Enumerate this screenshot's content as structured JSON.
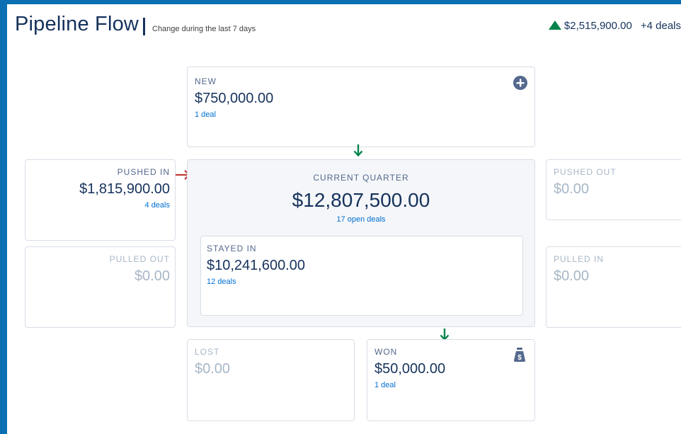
{
  "header": {
    "title": "Pipeline Flow",
    "subtitle": "Change during the last 7 days",
    "net_change": "$2,515,900.00",
    "net_deals": "+4 deals"
  },
  "cards": {
    "new": {
      "label": "NEW",
      "amount": "$750,000.00",
      "count": "1 deal"
    },
    "pushed_in": {
      "label": "PUSHED IN",
      "amount": "$1,815,900.00",
      "count": "4 deals"
    },
    "current_quarter": {
      "label": "CURRENT QUARTER",
      "amount": "$12,807,500.00",
      "count": "17 open deals"
    },
    "stayed_in": {
      "label": "STAYED IN",
      "amount": "$10,241,600.00",
      "count": "12 deals"
    },
    "pushed_out": {
      "label": "PUSHED OUT",
      "amount": "$0.00"
    },
    "pulled_out": {
      "label": "PULLED OUT",
      "amount": "$0.00"
    },
    "pulled_in": {
      "label": "PULLED IN",
      "amount": "$0.00"
    },
    "lost": {
      "label": "LOST",
      "amount": "$0.00"
    },
    "won": {
      "label": "WON",
      "amount": "$50,000.00",
      "count": "1 deal"
    }
  },
  "icons": {
    "add": "add-circle-icon",
    "money": "money-bag-icon",
    "arrow_positive": "arrow-down-icon",
    "arrow_pushed": "arrow-right-icon"
  },
  "colors": {
    "positive": "#04844b",
    "negative": "#c23934",
    "link": "#0070d2",
    "frame": "#0a6fb3"
  }
}
